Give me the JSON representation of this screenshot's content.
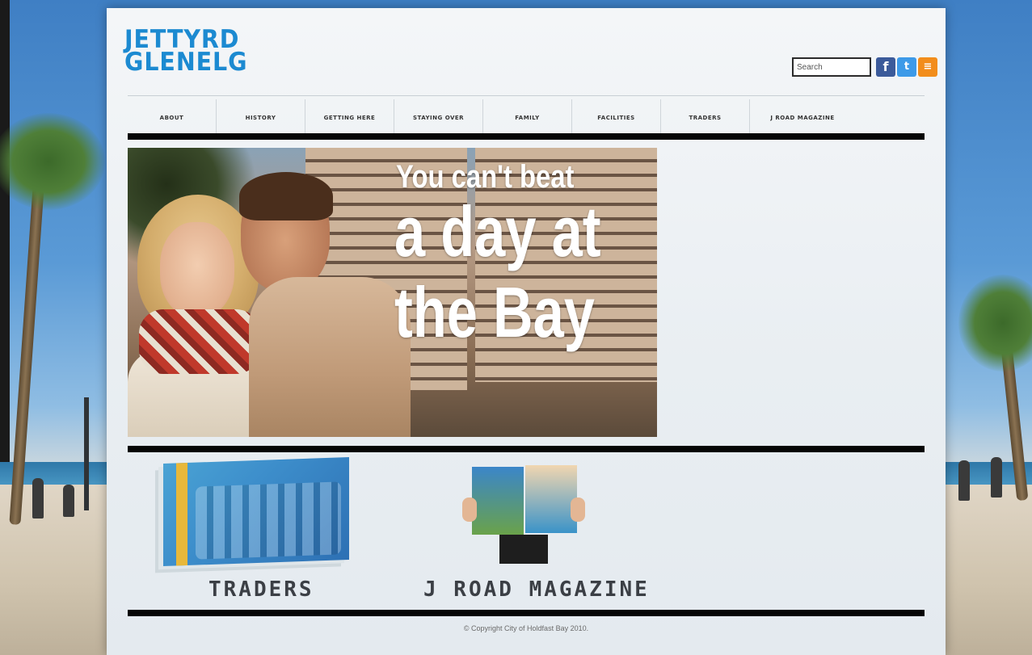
{
  "brand": {
    "line1": "JETTYRD",
    "line2": "GLENELG"
  },
  "header": {
    "search_placeholder": "Search",
    "social": {
      "facebook": "f",
      "twitter": "t",
      "rss": "≡"
    }
  },
  "nav": {
    "items": [
      "ABOUT",
      "HISTORY",
      "GETTING HERE",
      "STAYING OVER",
      "FAMILY",
      "FACILITIES",
      "TRADERS",
      "J ROAD MAGAZINE"
    ]
  },
  "hero": {
    "line1": "You can't beat",
    "line2": "a day at",
    "line3": "the Bay"
  },
  "features": {
    "traders_label": "TRADERS",
    "magazine_label": "J ROAD MAGAZINE"
  },
  "footer": {
    "copyright": "© Copyright City of Holdfast Bay 2010."
  },
  "colors": {
    "brand_blue": "#1c8ad1",
    "rule": "#050505",
    "facebook": "#3b5a9a",
    "twitter": "#3d9ae8",
    "rss": "#f28d1b"
  }
}
